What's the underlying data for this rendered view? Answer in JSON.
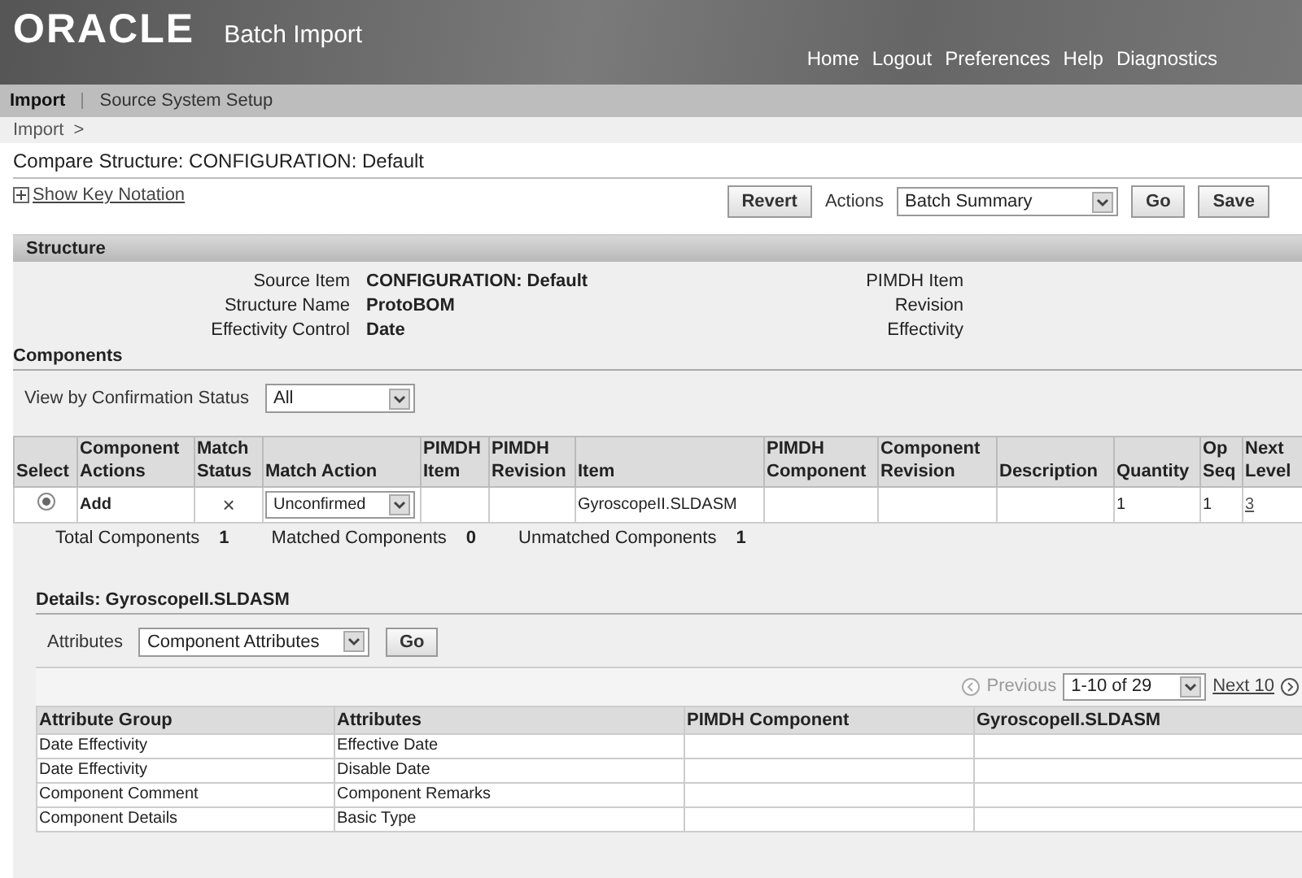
{
  "header": {
    "logo": "ORACLE",
    "app_title": "Batch Import",
    "global_links": [
      "Home",
      "Logout",
      "Preferences",
      "Help",
      "Diagnostics"
    ]
  },
  "tabs": [
    {
      "label": "Import",
      "selected": true
    },
    {
      "label": "Source System Setup",
      "selected": false
    }
  ],
  "breadcrumb": [
    "Import",
    ">"
  ],
  "page_title": "Compare Structure: CONFIGURATION: Default",
  "key_notation": {
    "label": "Show Key Notation",
    "expanded": false
  },
  "actions": {
    "revert": "Revert",
    "label": "Actions",
    "select_value": "Batch Summary",
    "go": "Go",
    "save": "Save"
  },
  "structure": {
    "title": "Structure",
    "left": [
      {
        "label": "Source Item",
        "value": "CONFIGURATION: Default"
      },
      {
        "label": "Structure Name",
        "value": "ProtoBOM"
      },
      {
        "label": "Effectivity Control",
        "value": "Date"
      }
    ],
    "right": [
      {
        "label": "PIMDH Item"
      },
      {
        "label": "Revision"
      },
      {
        "label": "Effectivity"
      }
    ]
  },
  "components": {
    "title": "Components",
    "filter_label": "View by Confirmation Status",
    "filter_value": "All",
    "columns": [
      "Select",
      "Component Actions",
      "Match Status",
      "Match Action",
      "PIMDH Item",
      "PIMDH Revision",
      "Item",
      "PIMDH Component",
      "Component Revision",
      "Description",
      "Quantity",
      "Op Seq",
      "Next Level"
    ],
    "rows": [
      {
        "selected": true,
        "action": "Add",
        "match_status": "×",
        "match_action": "Unconfirmed",
        "pimdh_item": "",
        "pimdh_revision": "",
        "item": "GyroscopeII.SLDASM",
        "pimdh_component": "",
        "component_revision": "",
        "description": "",
        "quantity": "1",
        "op_seq": "1",
        "next_level": "3"
      }
    ],
    "totals": [
      {
        "label": "Total Components",
        "value": "1"
      },
      {
        "label": "Matched Components",
        "value": "0"
      },
      {
        "label": "Unmatched Components",
        "value": "1"
      }
    ]
  },
  "details": {
    "title": "Details: GyroscopeII.SLDASM",
    "attributes_label": "Attributes",
    "attributes_value": "Component Attributes",
    "go": "Go",
    "pager": {
      "previous": "Previous",
      "range": "1-10 of 29",
      "next": "Next 10",
      "previous_disabled": true
    },
    "columns": [
      "Attribute Group",
      "Attributes",
      "PIMDH Component",
      "GyroscopeII.SLDASM"
    ],
    "rows": [
      [
        "Date Effectivity",
        "Effective Date",
        "",
        ""
      ],
      [
        "Date Effectivity",
        "Disable Date",
        "",
        ""
      ],
      [
        "Component Comment",
        "Component Remarks",
        "",
        ""
      ],
      [
        "Component Details",
        "Basic Type",
        "",
        ""
      ]
    ]
  }
}
